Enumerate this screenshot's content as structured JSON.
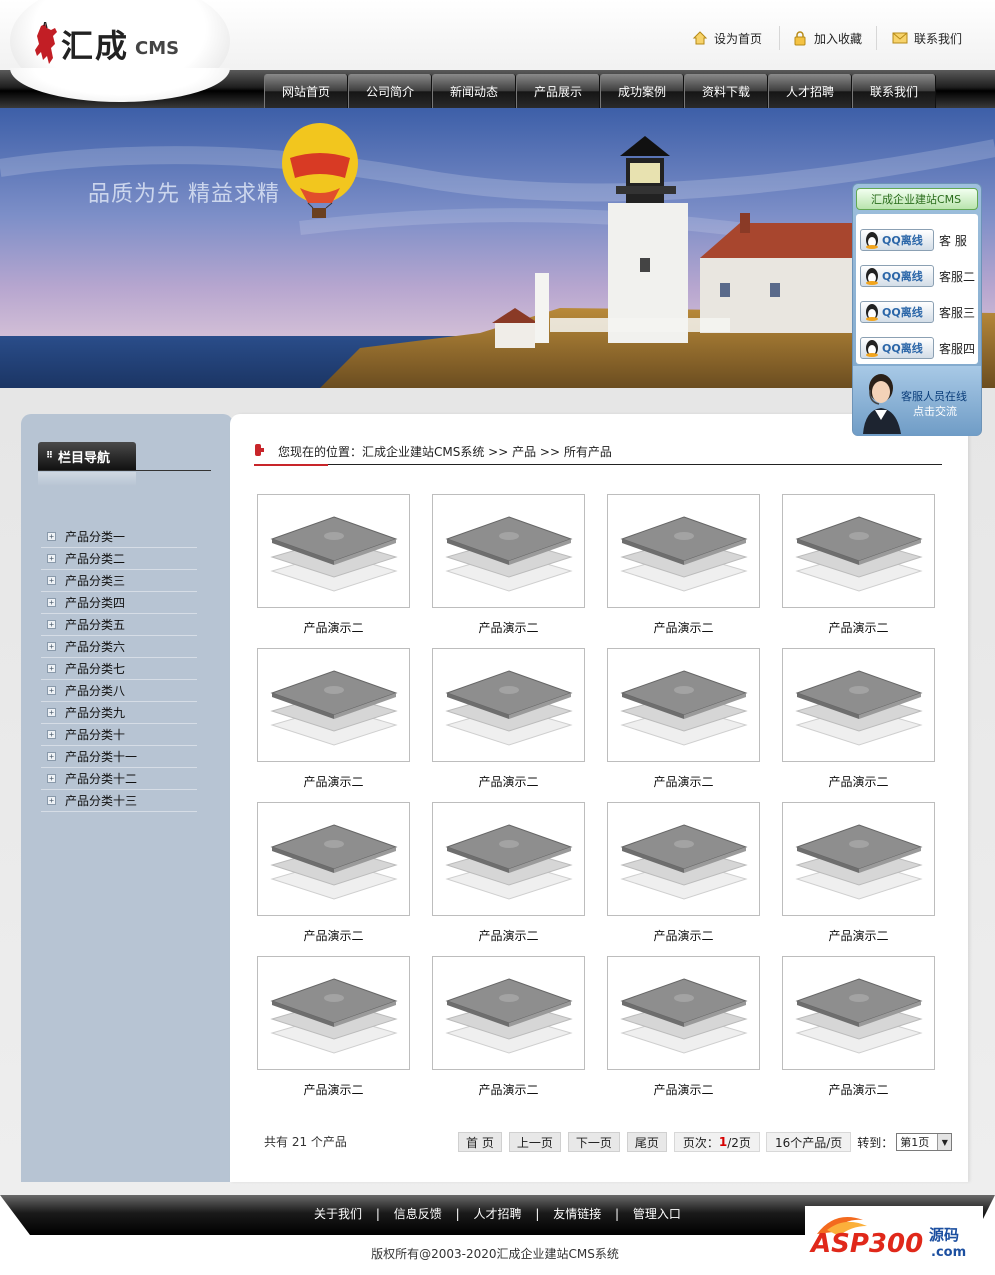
{
  "header": {
    "brand": "汇成",
    "brand_suffix": "CMS",
    "quick_links": {
      "home": "设为首页",
      "favorite": "加入收藏",
      "contact": "联系我们"
    }
  },
  "nav": {
    "items": [
      "网站首页",
      "公司简介",
      "新闻动态",
      "产品展示",
      "成功案例",
      "资料下载",
      "人才招聘",
      "联系我们"
    ]
  },
  "banner": {
    "slogan": "品质为先 精益求精"
  },
  "sidebar": {
    "title": "栏目导航",
    "categories": [
      "产品分类一",
      "产品分类二",
      "产品分类三",
      "产品分类四",
      "产品分类五",
      "产品分类六",
      "产品分类七",
      "产品分类八",
      "产品分类九",
      "产品分类十",
      "产品分类十一",
      "产品分类十二",
      "产品分类十三"
    ]
  },
  "breadcrumb": {
    "text": "您现在的位置：汇成企业建站CMS系统 >> 产品 >> 所有产品"
  },
  "products": [
    {
      "name": "产品演示二"
    },
    {
      "name": "产品演示二"
    },
    {
      "name": "产品演示二"
    },
    {
      "name": "产品演示二"
    },
    {
      "name": "产品演示二"
    },
    {
      "name": "产品演示二"
    },
    {
      "name": "产品演示二"
    },
    {
      "name": "产品演示二"
    },
    {
      "name": "产品演示二"
    },
    {
      "name": "产品演示二"
    },
    {
      "name": "产品演示二"
    },
    {
      "name": "产品演示二"
    },
    {
      "name": "产品演示二"
    },
    {
      "name": "产品演示二"
    },
    {
      "name": "产品演示二"
    },
    {
      "name": "产品演示二"
    }
  ],
  "pagination": {
    "total": "共有 21 个产品",
    "first": "首 页",
    "prev": "上一页",
    "next": "下一页",
    "last": "尾页",
    "page_label": "页次：",
    "current_page": "1",
    "total_pages": "/2页",
    "per_page": "16个产品/页",
    "jump_label": "转到：",
    "jump_value": "第1页"
  },
  "qq": {
    "title": "汇成企业建站CMS",
    "status": "QQ离线",
    "agents": [
      "客 服",
      "客服二",
      "客服三",
      "客服四"
    ],
    "footer_line1": "客服人员在线",
    "footer_line2": "点击交流"
  },
  "footer": {
    "links": [
      "关于我们",
      "信息反馈",
      "人才招聘",
      "友情链接",
      "管理入口"
    ],
    "separator": "|",
    "copyright": "版权所有@2003-2020汇成企业建站CMS系统"
  },
  "watermark": {
    "text": "ASP300源码",
    "domain": ".com"
  },
  "colors": {
    "accent_red": "#c8252a",
    "sidebar_bg": "#b7c4d3",
    "nav_bg": "#1f1f1f",
    "qq_green": "#62a852"
  }
}
